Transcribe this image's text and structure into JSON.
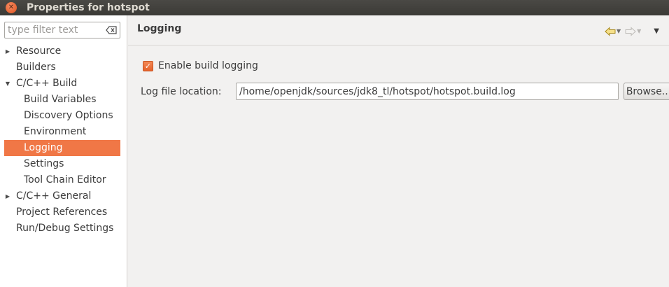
{
  "window": {
    "title": "Properties for hotspot"
  },
  "sidebar": {
    "filter_placeholder": "type filter text",
    "items": [
      {
        "label": "Resource",
        "level": 0,
        "expandable": true,
        "expanded": false
      },
      {
        "label": "Builders",
        "level": 0,
        "expandable": false
      },
      {
        "label": "C/C++ Build",
        "level": 0,
        "expandable": true,
        "expanded": true
      },
      {
        "label": "Build Variables",
        "level": 1
      },
      {
        "label": "Discovery Options",
        "level": 1
      },
      {
        "label": "Environment",
        "level": 1
      },
      {
        "label": "Logging",
        "level": 1,
        "selected": true
      },
      {
        "label": "Settings",
        "level": 1
      },
      {
        "label": "Tool Chain Editor",
        "level": 1
      },
      {
        "label": "C/C++ General",
        "level": 0,
        "expandable": true,
        "expanded": false
      },
      {
        "label": "Project References",
        "level": 0,
        "expandable": false
      },
      {
        "label": "Run/Debug Settings",
        "level": 0,
        "expandable": false
      }
    ]
  },
  "page": {
    "title": "Logging",
    "enable_logging_label": "Enable build logging",
    "enable_logging_checked": true,
    "log_location_label": "Log file location:",
    "log_location_value": "/home/openjdk/sources/jdk8_tl/hotspot/hotspot.build.log",
    "browse_label": "Browse..."
  },
  "colors": {
    "selection": "#f07746",
    "titlebar": "#3c3b37",
    "accent_checkbox": "#e96a35"
  },
  "icons": {
    "close": "close-icon",
    "clear_filter": "clear-filter-icon",
    "back": "back-arrow-icon",
    "forward": "forward-arrow-icon",
    "view_menu": "view-menu-icon"
  }
}
